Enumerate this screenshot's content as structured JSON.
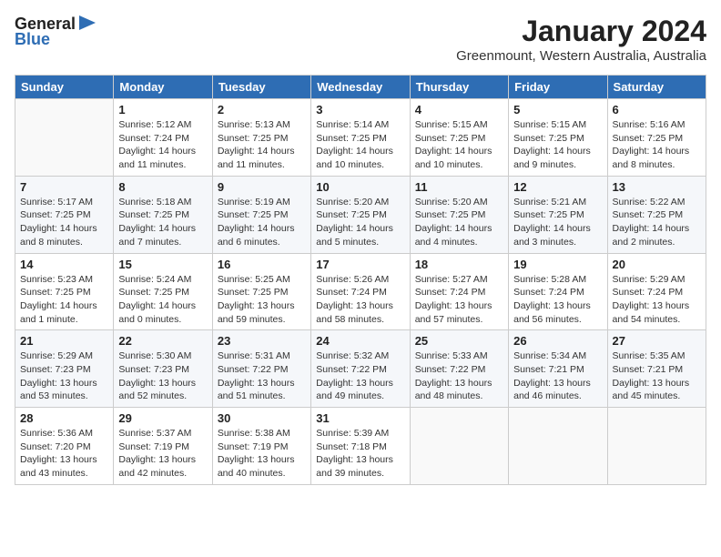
{
  "header": {
    "logo_line1": "General",
    "logo_line2": "Blue",
    "month": "January 2024",
    "location": "Greenmount, Western Australia, Australia"
  },
  "weekdays": [
    "Sunday",
    "Monday",
    "Tuesday",
    "Wednesday",
    "Thursday",
    "Friday",
    "Saturday"
  ],
  "weeks": [
    [
      {
        "day": "",
        "info": ""
      },
      {
        "day": "1",
        "info": "Sunrise: 5:12 AM\nSunset: 7:24 PM\nDaylight: 14 hours\nand 11 minutes."
      },
      {
        "day": "2",
        "info": "Sunrise: 5:13 AM\nSunset: 7:25 PM\nDaylight: 14 hours\nand 11 minutes."
      },
      {
        "day": "3",
        "info": "Sunrise: 5:14 AM\nSunset: 7:25 PM\nDaylight: 14 hours\nand 10 minutes."
      },
      {
        "day": "4",
        "info": "Sunrise: 5:15 AM\nSunset: 7:25 PM\nDaylight: 14 hours\nand 10 minutes."
      },
      {
        "day": "5",
        "info": "Sunrise: 5:15 AM\nSunset: 7:25 PM\nDaylight: 14 hours\nand 9 minutes."
      },
      {
        "day": "6",
        "info": "Sunrise: 5:16 AM\nSunset: 7:25 PM\nDaylight: 14 hours\nand 8 minutes."
      }
    ],
    [
      {
        "day": "7",
        "info": "Sunrise: 5:17 AM\nSunset: 7:25 PM\nDaylight: 14 hours\nand 8 minutes."
      },
      {
        "day": "8",
        "info": "Sunrise: 5:18 AM\nSunset: 7:25 PM\nDaylight: 14 hours\nand 7 minutes."
      },
      {
        "day": "9",
        "info": "Sunrise: 5:19 AM\nSunset: 7:25 PM\nDaylight: 14 hours\nand 6 minutes."
      },
      {
        "day": "10",
        "info": "Sunrise: 5:20 AM\nSunset: 7:25 PM\nDaylight: 14 hours\nand 5 minutes."
      },
      {
        "day": "11",
        "info": "Sunrise: 5:20 AM\nSunset: 7:25 PM\nDaylight: 14 hours\nand 4 minutes."
      },
      {
        "day": "12",
        "info": "Sunrise: 5:21 AM\nSunset: 7:25 PM\nDaylight: 14 hours\nand 3 minutes."
      },
      {
        "day": "13",
        "info": "Sunrise: 5:22 AM\nSunset: 7:25 PM\nDaylight: 14 hours\nand 2 minutes."
      }
    ],
    [
      {
        "day": "14",
        "info": "Sunrise: 5:23 AM\nSunset: 7:25 PM\nDaylight: 14 hours\nand 1 minute."
      },
      {
        "day": "15",
        "info": "Sunrise: 5:24 AM\nSunset: 7:25 PM\nDaylight: 14 hours\nand 0 minutes."
      },
      {
        "day": "16",
        "info": "Sunrise: 5:25 AM\nSunset: 7:25 PM\nDaylight: 13 hours\nand 59 minutes."
      },
      {
        "day": "17",
        "info": "Sunrise: 5:26 AM\nSunset: 7:24 PM\nDaylight: 13 hours\nand 58 minutes."
      },
      {
        "day": "18",
        "info": "Sunrise: 5:27 AM\nSunset: 7:24 PM\nDaylight: 13 hours\nand 57 minutes."
      },
      {
        "day": "19",
        "info": "Sunrise: 5:28 AM\nSunset: 7:24 PM\nDaylight: 13 hours\nand 56 minutes."
      },
      {
        "day": "20",
        "info": "Sunrise: 5:29 AM\nSunset: 7:24 PM\nDaylight: 13 hours\nand 54 minutes."
      }
    ],
    [
      {
        "day": "21",
        "info": "Sunrise: 5:29 AM\nSunset: 7:23 PM\nDaylight: 13 hours\nand 53 minutes."
      },
      {
        "day": "22",
        "info": "Sunrise: 5:30 AM\nSunset: 7:23 PM\nDaylight: 13 hours\nand 52 minutes."
      },
      {
        "day": "23",
        "info": "Sunrise: 5:31 AM\nSunset: 7:22 PM\nDaylight: 13 hours\nand 51 minutes."
      },
      {
        "day": "24",
        "info": "Sunrise: 5:32 AM\nSunset: 7:22 PM\nDaylight: 13 hours\nand 49 minutes."
      },
      {
        "day": "25",
        "info": "Sunrise: 5:33 AM\nSunset: 7:22 PM\nDaylight: 13 hours\nand 48 minutes."
      },
      {
        "day": "26",
        "info": "Sunrise: 5:34 AM\nSunset: 7:21 PM\nDaylight: 13 hours\nand 46 minutes."
      },
      {
        "day": "27",
        "info": "Sunrise: 5:35 AM\nSunset: 7:21 PM\nDaylight: 13 hours\nand 45 minutes."
      }
    ],
    [
      {
        "day": "28",
        "info": "Sunrise: 5:36 AM\nSunset: 7:20 PM\nDaylight: 13 hours\nand 43 minutes."
      },
      {
        "day": "29",
        "info": "Sunrise: 5:37 AM\nSunset: 7:19 PM\nDaylight: 13 hours\nand 42 minutes."
      },
      {
        "day": "30",
        "info": "Sunrise: 5:38 AM\nSunset: 7:19 PM\nDaylight: 13 hours\nand 40 minutes."
      },
      {
        "day": "31",
        "info": "Sunrise: 5:39 AM\nSunset: 7:18 PM\nDaylight: 13 hours\nand 39 minutes."
      },
      {
        "day": "",
        "info": ""
      },
      {
        "day": "",
        "info": ""
      },
      {
        "day": "",
        "info": ""
      }
    ]
  ]
}
